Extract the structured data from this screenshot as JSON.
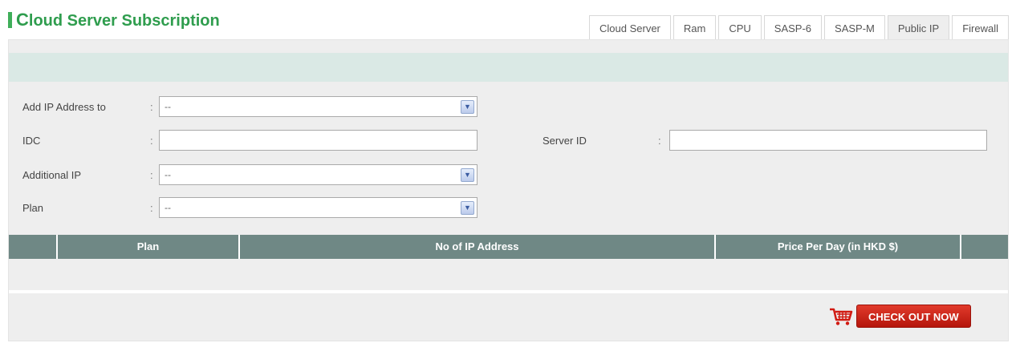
{
  "header": {
    "title_first": "C",
    "title_rest": "loud Server Subscription"
  },
  "tabs": [
    {
      "label": "Cloud Server",
      "active": false
    },
    {
      "label": "Ram",
      "active": false
    },
    {
      "label": "CPU",
      "active": false
    },
    {
      "label": "SASP-6",
      "active": false
    },
    {
      "label": "SASP-M",
      "active": false
    },
    {
      "label": "Public IP",
      "active": true
    },
    {
      "label": "Firewall",
      "active": false
    }
  ],
  "form": {
    "add_ip_label": "Add IP Address to",
    "add_ip_value": "--",
    "idc_label": "IDC",
    "idc_value": "",
    "server_id_label": "Server ID",
    "server_id_value": "",
    "additional_ip_label": "Additional IP",
    "additional_ip_value": "--",
    "plan_label": "Plan",
    "plan_value": "--",
    "colon": ":"
  },
  "table": {
    "columns": [
      "",
      "Plan",
      "No of IP Address",
      "Price Per Day (in HKD $)",
      ""
    ]
  },
  "checkout": {
    "label": "CHECK OUT NOW"
  },
  "colors": {
    "title": "#2f9d4e",
    "header_bar": "#dae9e5",
    "table_head": "#6f8885",
    "checkout": "#c8231a"
  }
}
